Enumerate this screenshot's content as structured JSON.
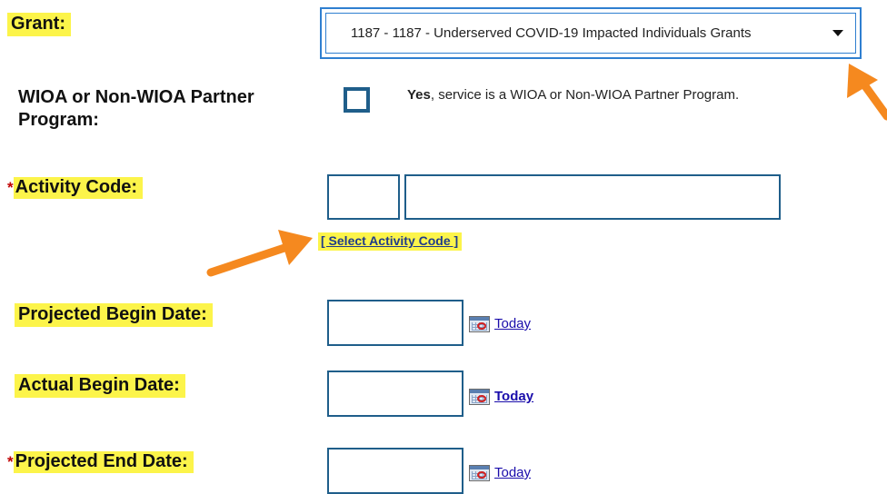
{
  "grant": {
    "label": "Grant:",
    "selected": "1187 - 1187 - Underserved COVID-19 Impacted Individuals Grants"
  },
  "wioa": {
    "label_line1": "WIOA or Non-WIOA Partner",
    "label_line2": "Program:",
    "yes_bold": "Yes",
    "yes_rest": ", service is a WIOA or Non-WIOA Partner Program."
  },
  "activity_code": {
    "required": "*",
    "label": "Activity Code:",
    "code_value": "",
    "desc_value": "",
    "select_link": "[ Select Activity Code ]"
  },
  "projected_begin": {
    "label": "Projected Begin Date:",
    "value": "",
    "today": "Today"
  },
  "actual_begin": {
    "label": "Actual Begin Date:",
    "value": "",
    "today": "Today"
  },
  "projected_end": {
    "required": "*",
    "label": "Projected End Date:",
    "value": "",
    "today": "Today"
  },
  "icons": {
    "calendar": "calendar-icon",
    "dropdown": "chevron-down-icon",
    "annotation": "arrow-annotation"
  },
  "colors": {
    "highlight": "#fcf44a",
    "border": "#1f5e8a",
    "arrow": "#f5891f",
    "link": "#1a0dab",
    "required": "#c00000"
  }
}
